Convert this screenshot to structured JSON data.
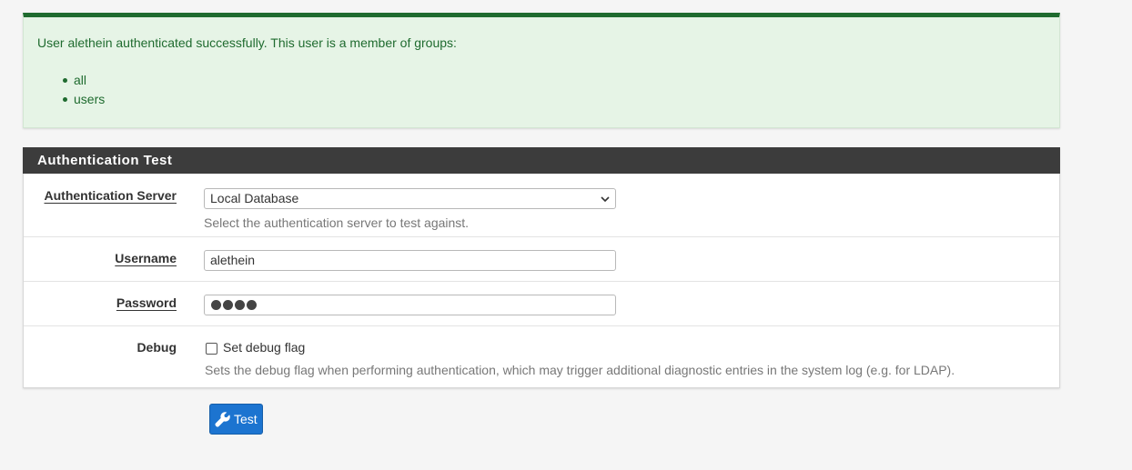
{
  "alert": {
    "message": "User alethein authenticated successfully. This user is a member of groups:",
    "groups": [
      "all",
      "users"
    ],
    "accent_color": "#1f6b2f",
    "background_color": "#e6f4e6"
  },
  "panel": {
    "title": "Authentication Test",
    "auth_server": {
      "label": "Authentication Server",
      "value": "Local Database",
      "help": "Select the authentication server to test against.",
      "icon": "chevron-down-icon"
    },
    "username": {
      "label": "Username",
      "value": "alethein"
    },
    "password": {
      "label": "Password",
      "masked_length": 4
    },
    "debug": {
      "label": "Debug",
      "checkbox_label": "Set debug flag",
      "checked": false,
      "help": "Sets the debug flag when performing authentication, which may trigger additional diagnostic entries in the system log (e.g. for LDAP)."
    }
  },
  "test_button": {
    "label": "Test",
    "icon": "wrench-icon",
    "color": "#1c74d0"
  }
}
